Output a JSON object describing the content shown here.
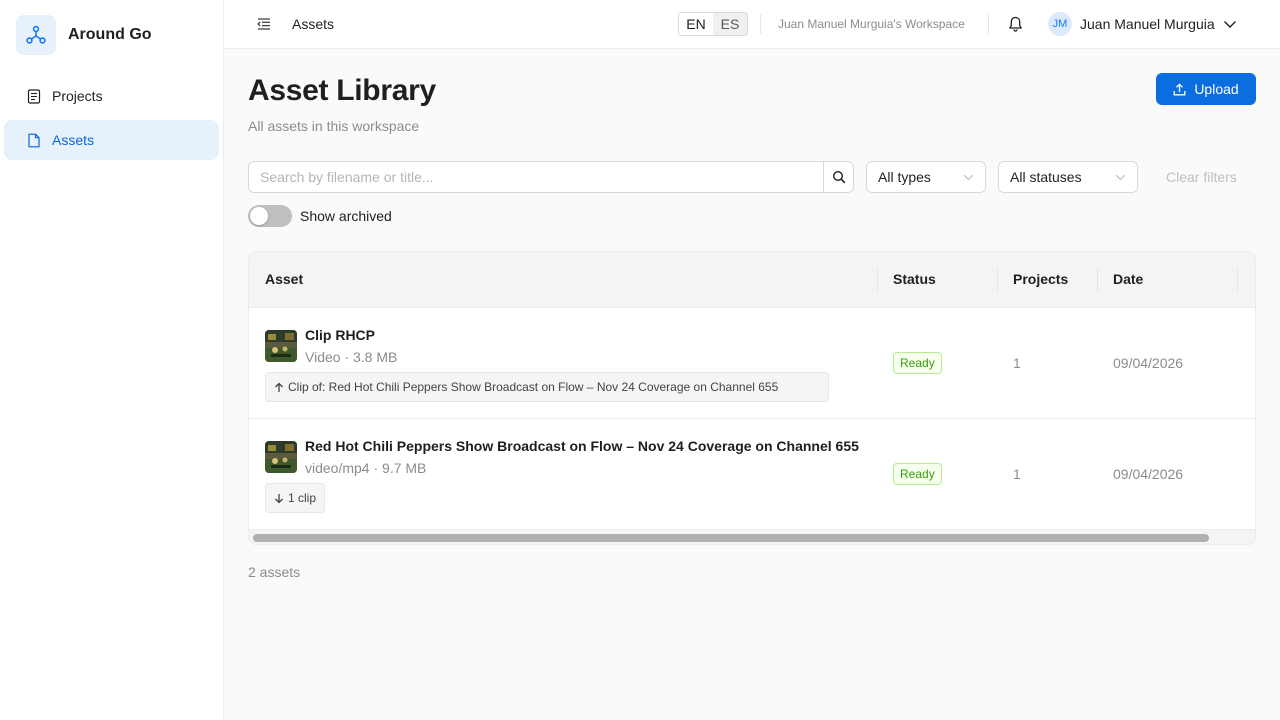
{
  "app": {
    "name": "Around Go"
  },
  "sidebar": {
    "items": [
      {
        "label": "Projects",
        "icon": "document-list-icon"
      },
      {
        "label": "Assets",
        "icon": "file-icon"
      }
    ]
  },
  "header": {
    "title": "Assets",
    "languages": [
      "EN",
      "ES"
    ],
    "active_language": "EN",
    "workspace": "Juan Manuel Murguia's Workspace",
    "user": {
      "initials": "JM",
      "name": "Juan Manuel Murguia"
    }
  },
  "page": {
    "title": "Asset Library",
    "subtitle": "All assets in this workspace",
    "upload_label": "Upload"
  },
  "filters": {
    "search_placeholder": "Search by filename or title...",
    "type": "All types",
    "status": "All statuses",
    "clear_label": "Clear filters",
    "show_archived_label": "Show archived",
    "show_archived": false
  },
  "table": {
    "columns": [
      "Asset",
      "Status",
      "Projects",
      "Date"
    ],
    "rows": [
      {
        "title": "Clip RHCP",
        "meta": "Video · 3.8 MB",
        "chip": "Clip of: Red Hot Chili Peppers Show Broadcast on Flow – Nov 24 Coverage on Channel 655",
        "chip_icon": "arrow-up-icon",
        "status": "Ready",
        "projects": "1",
        "date": "09/04/2026"
      },
      {
        "title": "Red Hot Chili Peppers Show Broadcast on Flow – Nov 24 Coverage on Channel 655",
        "meta": "video/mp4 · 9.7 MB",
        "chip": "1 clip",
        "chip_icon": "arrow-down-icon",
        "status": "Ready",
        "projects": "1",
        "date": "09/04/2026"
      }
    ]
  },
  "footer": {
    "total": "2 assets"
  },
  "colors": {
    "primary": "#0b6ee0",
    "active_nav_bg": "#e6f1fc",
    "ready_green": "#389e0d"
  }
}
